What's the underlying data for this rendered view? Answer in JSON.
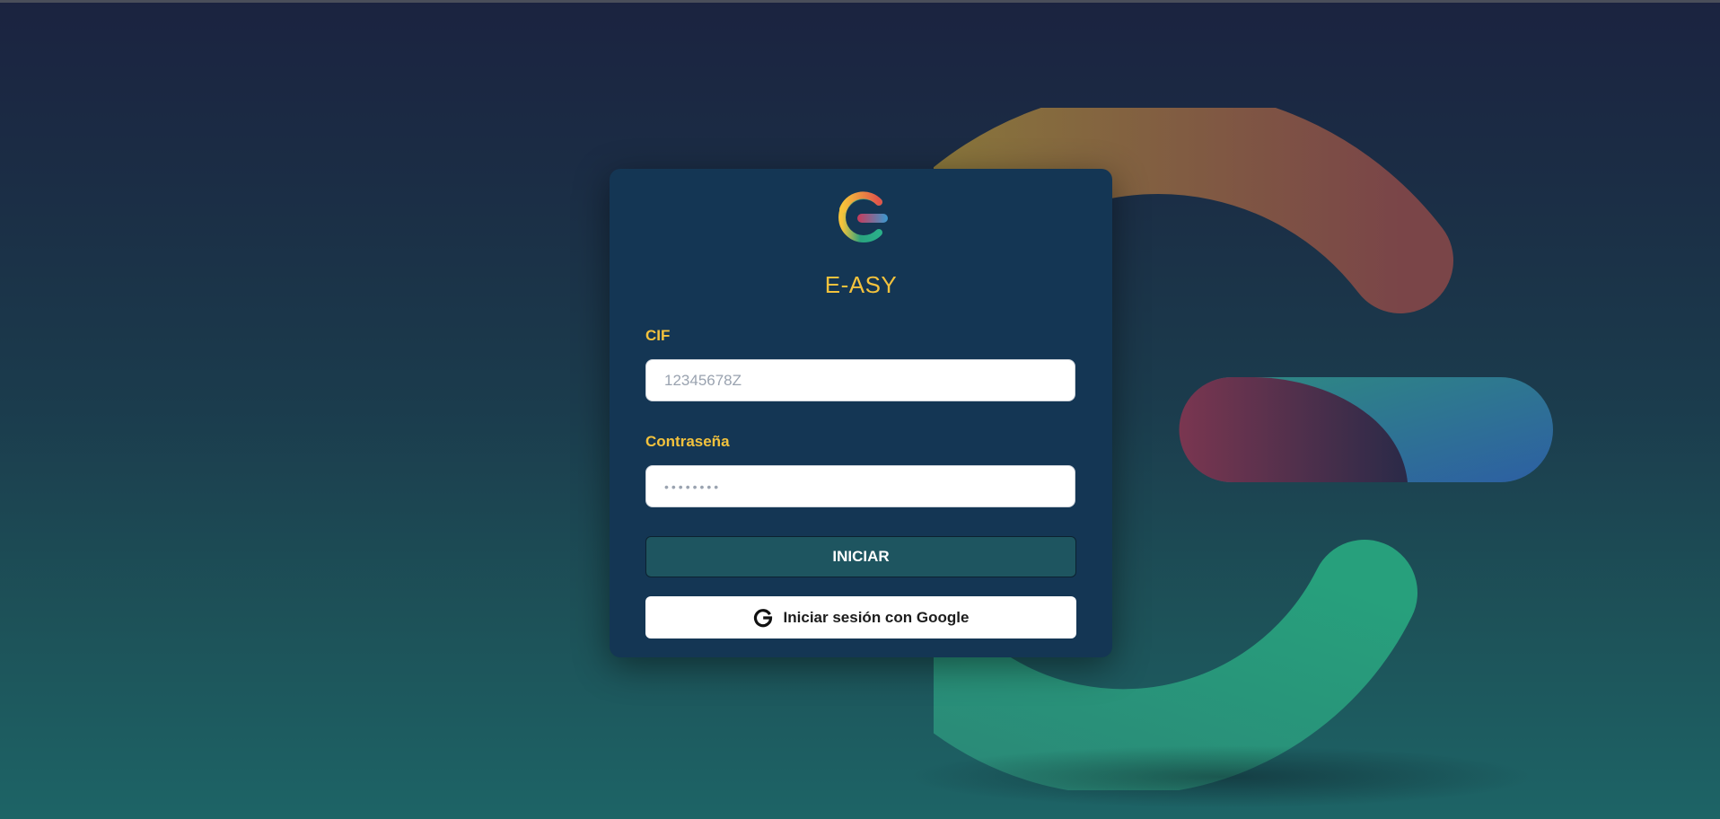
{
  "brand": {
    "name": "E-ASY"
  },
  "form": {
    "cif_label": "CIF",
    "cif_placeholder": "12345678Z",
    "password_label": "Contraseña",
    "password_placeholder": "••••••••",
    "submit_label": "INICIAR",
    "google_label": "Iniciar sesión con Google"
  },
  "icons": {
    "logo": "easy-g-logo-icon",
    "google": "google-g-icon"
  },
  "colors": {
    "accent": "#f3c23d",
    "card_background": "#143654",
    "primary_button": "#1e5560",
    "logo_orange": "#f08a3a",
    "logo_red": "#c93a5a",
    "logo_teal": "#2aa37e",
    "logo_blue": "#3a63b0"
  }
}
